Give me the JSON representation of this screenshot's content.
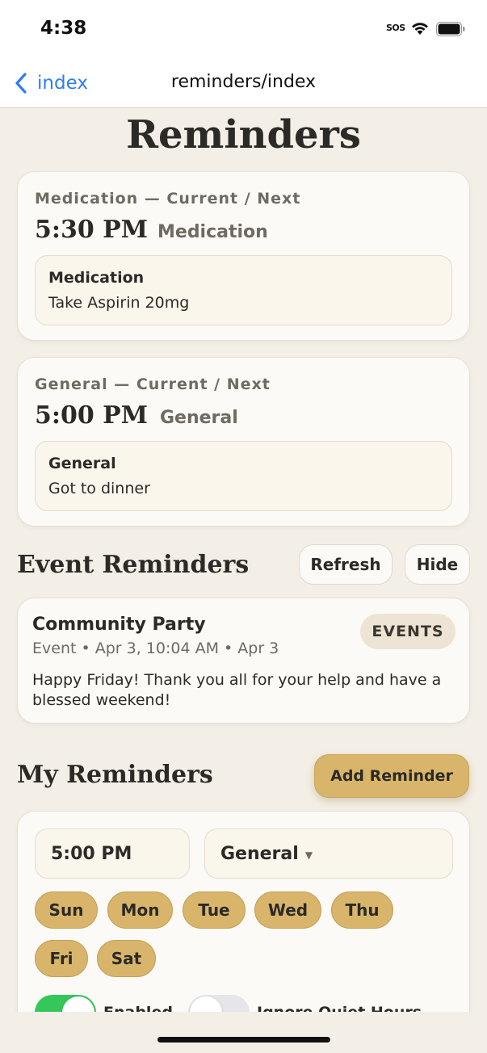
{
  "status_bar": {
    "time": "4:38",
    "sos": "SOS"
  },
  "nav": {
    "back_label": "index",
    "title": "reminders/index"
  },
  "page": {
    "title": "Reminders"
  },
  "current_cards": [
    {
      "label": "Medication — Current / Next",
      "time": "5:30 PM",
      "category": "Medication",
      "item_title": "Medication",
      "item_text": "Take Aspirin 20mg"
    },
    {
      "label": "General — Current / Next",
      "time": "5:00 PM",
      "category": "General",
      "item_title": "General",
      "item_text": "Got to dinner"
    }
  ],
  "event_reminders": {
    "title": "Event Reminders",
    "refresh_label": "Refresh",
    "hide_label": "Hide",
    "event": {
      "title": "Community Party",
      "meta": "Event • Apr 3, 10:04 AM • Apr 3",
      "badge": "EVENTS",
      "description": "Happy Friday! Thank you all for your help and have a blessed weekend!"
    }
  },
  "my_reminders": {
    "title": "My Reminders",
    "add_label": "Add Reminder",
    "form": {
      "time": "5:00 PM",
      "category": "General",
      "days": [
        "Sun",
        "Mon",
        "Tue",
        "Wed",
        "Thu",
        "Fri",
        "Sat"
      ],
      "enabled_label": "Enabled",
      "enabled": true,
      "ignore_quiet_label": "Ignore Quiet Hours",
      "ignore_quiet": false
    }
  },
  "colors": {
    "background": "#f4efe6",
    "card": "#fcfaf6",
    "accent_gold": "#d9b56b",
    "ios_blue": "#2f7cf6",
    "toggle_on": "#34c759",
    "toggle_off": "#e6e6ea"
  }
}
